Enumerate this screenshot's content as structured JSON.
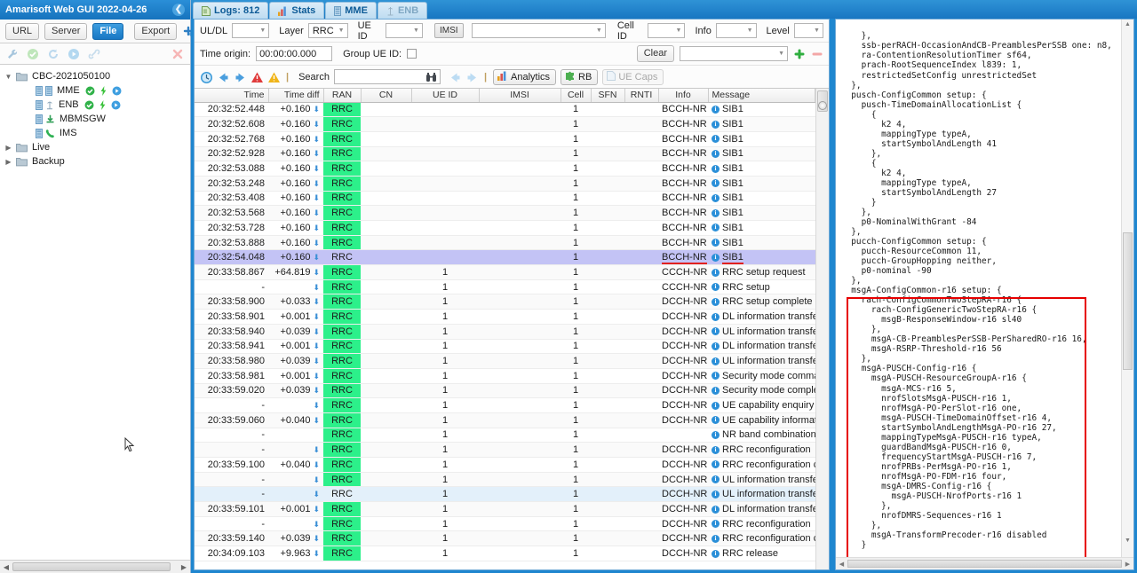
{
  "window": {
    "title": "Amarisoft Web GUI 2022-04-26",
    "collapse_icon": "chevron-left-icon"
  },
  "left_panel": {
    "source_buttons": [
      {
        "label": "URL",
        "active": false
      },
      {
        "label": "Server",
        "active": false
      },
      {
        "label": "File",
        "active": true
      }
    ],
    "export_label": "Export",
    "add_icon": "add-config-icon",
    "action_icons": [
      "wrench-icon",
      "check-circle-icon",
      "refresh-icon",
      "play-circle-icon",
      "link-icon"
    ],
    "delete_icon": "delete-x-icon",
    "tree": [
      {
        "label": "CBC-2021050100",
        "depth": 0,
        "expanded": true,
        "icon": "folder-icon",
        "badges": []
      },
      {
        "label": "MME",
        "depth": 1,
        "expanded": null,
        "icon": "server-icon",
        "badges": [
          "status-ok-icon",
          "bolt-icon",
          "play-icon"
        ]
      },
      {
        "label": "ENB",
        "depth": 1,
        "expanded": null,
        "icon": "antenna-icon",
        "badges": [
          "status-ok-icon",
          "bolt-icon",
          "play-icon"
        ]
      },
      {
        "label": "MBMSGW",
        "depth": 1,
        "expanded": null,
        "icon": "download-icon",
        "badges": []
      },
      {
        "label": "IMS",
        "depth": 1,
        "expanded": null,
        "icon": "phone-icon",
        "badges": []
      },
      {
        "label": "Live",
        "depth": 0,
        "expanded": false,
        "icon": "folder-icon",
        "badges": []
      },
      {
        "label": "Backup",
        "depth": 0,
        "expanded": false,
        "icon": "folder-icon",
        "badges": []
      }
    ]
  },
  "tabs": [
    {
      "label": "Logs: 812",
      "icon": "document-icon",
      "active": true,
      "disabled": false
    },
    {
      "label": "Stats",
      "icon": "bar-chart-icon",
      "active": false,
      "disabled": false
    },
    {
      "label": "MME",
      "icon": "server-icon",
      "active": false,
      "disabled": false
    },
    {
      "label": "ENB",
      "icon": "antenna-icon",
      "active": false,
      "disabled": true
    }
  ],
  "filters": {
    "uldl_label": "UL/DL",
    "uldl_value": "",
    "layer_label": "Layer",
    "layer_value": "RRC",
    "ueid_label": "UE ID",
    "ueid_value": "",
    "imsi_button": "IMSI",
    "imsi_value": "",
    "cellid_label": "Cell ID",
    "cellid_value": "",
    "info_label": "Info",
    "info_value": "",
    "level_label": "Level",
    "level_value": ""
  },
  "filters2": {
    "time_origin_label": "Time origin:",
    "time_origin_value": "00:00:00.000",
    "group_ueid_label": "Group UE ID:",
    "group_ueid_checked": false,
    "clear_label": "Clear",
    "preset_value": "",
    "add_icon": "plus-green-icon",
    "remove_icon": "minus-red-icon"
  },
  "toolbar": {
    "clock_icon": "clock-icon",
    "prev_icon": "arrow-left-icon",
    "next_icon": "arrow-right-icon",
    "error_icon": "error-triangle-icon",
    "warn_icon": "warning-triangle-icon",
    "search_label": "Search",
    "search_value": "",
    "search_placeholder": "",
    "binoculars_icon": "binoculars-icon",
    "search_prev_icon": "arrow-left-icon",
    "search_next_icon": "arrow-right-icon",
    "analytics_label": "Analytics",
    "analytics_icon": "bar-chart-icon",
    "rb_label": "RB",
    "rb_icon": "puzzle-icon",
    "uecaps_label": "UE Caps",
    "uecaps_icon": "document-icon",
    "uecaps_disabled": true
  },
  "table": {
    "columns": [
      "Time",
      "Time diff",
      "RAN",
      "CN",
      "UE ID",
      "IMSI",
      "Cell",
      "SFN",
      "RNTI",
      "Info",
      "Message"
    ],
    "rows": [
      {
        "time": "20:32:52.448",
        "diff": "+0.160",
        "arrow": true,
        "ran": "RRC",
        "cn": "",
        "ueid": "",
        "imsi": "",
        "cell": "1",
        "sfn": "",
        "rnti": "",
        "info": "BCCH-NR",
        "message": "SIB1",
        "state": ""
      },
      {
        "time": "20:32:52.608",
        "diff": "+0.160",
        "arrow": true,
        "ran": "RRC",
        "cn": "",
        "ueid": "",
        "imsi": "",
        "cell": "1",
        "sfn": "",
        "rnti": "",
        "info": "BCCH-NR",
        "message": "SIB1",
        "state": ""
      },
      {
        "time": "20:32:52.768",
        "diff": "+0.160",
        "arrow": true,
        "ran": "RRC",
        "cn": "",
        "ueid": "",
        "imsi": "",
        "cell": "1",
        "sfn": "",
        "rnti": "",
        "info": "BCCH-NR",
        "message": "SIB1",
        "state": ""
      },
      {
        "time": "20:32:52.928",
        "diff": "+0.160",
        "arrow": true,
        "ran": "RRC",
        "cn": "",
        "ueid": "",
        "imsi": "",
        "cell": "1",
        "sfn": "",
        "rnti": "",
        "info": "BCCH-NR",
        "message": "SIB1",
        "state": ""
      },
      {
        "time": "20:32:53.088",
        "diff": "+0.160",
        "arrow": true,
        "ran": "RRC",
        "cn": "",
        "ueid": "",
        "imsi": "",
        "cell": "1",
        "sfn": "",
        "rnti": "",
        "info": "BCCH-NR",
        "message": "SIB1",
        "state": ""
      },
      {
        "time": "20:32:53.248",
        "diff": "+0.160",
        "arrow": true,
        "ran": "RRC",
        "cn": "",
        "ueid": "",
        "imsi": "",
        "cell": "1",
        "sfn": "",
        "rnti": "",
        "info": "BCCH-NR",
        "message": "SIB1",
        "state": ""
      },
      {
        "time": "20:32:53.408",
        "diff": "+0.160",
        "arrow": true,
        "ran": "RRC",
        "cn": "",
        "ueid": "",
        "imsi": "",
        "cell": "1",
        "sfn": "",
        "rnti": "",
        "info": "BCCH-NR",
        "message": "SIB1",
        "state": ""
      },
      {
        "time": "20:32:53.568",
        "diff": "+0.160",
        "arrow": true,
        "ran": "RRC",
        "cn": "",
        "ueid": "",
        "imsi": "",
        "cell": "1",
        "sfn": "",
        "rnti": "",
        "info": "BCCH-NR",
        "message": "SIB1",
        "state": ""
      },
      {
        "time": "20:32:53.728",
        "diff": "+0.160",
        "arrow": true,
        "ran": "RRC",
        "cn": "",
        "ueid": "",
        "imsi": "",
        "cell": "1",
        "sfn": "",
        "rnti": "",
        "info": "BCCH-NR",
        "message": "SIB1",
        "state": ""
      },
      {
        "time": "20:32:53.888",
        "diff": "+0.160",
        "arrow": true,
        "ran": "RRC",
        "cn": "",
        "ueid": "",
        "imsi": "",
        "cell": "1",
        "sfn": "",
        "rnti": "",
        "info": "BCCH-NR",
        "message": "SIB1",
        "state": ""
      },
      {
        "time": "20:32:54.048",
        "diff": "+0.160",
        "arrow": true,
        "ran": "RRC",
        "cn": "",
        "ueid": "",
        "imsi": "",
        "cell": "1",
        "sfn": "",
        "rnti": "",
        "info": "BCCH-NR",
        "message": "SIB1",
        "state": "selected",
        "underline": true
      },
      {
        "time": "20:33:58.867",
        "diff": "+64.819",
        "arrow": true,
        "ran": "RRC",
        "cn": "",
        "ueid": "1",
        "imsi": "",
        "cell": "1",
        "sfn": "",
        "rnti": "",
        "info": "CCCH-NR",
        "message": "RRC setup request",
        "state": ""
      },
      {
        "time": "-",
        "diff": "",
        "arrow": true,
        "ran": "RRC",
        "cn": "",
        "ueid": "1",
        "imsi": "",
        "cell": "1",
        "sfn": "",
        "rnti": "",
        "info": "CCCH-NR",
        "message": "RRC setup",
        "state": ""
      },
      {
        "time": "20:33:58.900",
        "diff": "+0.033",
        "arrow": true,
        "ran": "RRC",
        "cn": "",
        "ueid": "1",
        "imsi": "",
        "cell": "1",
        "sfn": "",
        "rnti": "",
        "info": "DCCH-NR",
        "message": "RRC setup complete",
        "state": ""
      },
      {
        "time": "20:33:58.901",
        "diff": "+0.001",
        "arrow": true,
        "ran": "RRC",
        "cn": "",
        "ueid": "1",
        "imsi": "",
        "cell": "1",
        "sfn": "",
        "rnti": "",
        "info": "DCCH-NR",
        "message": "DL information transfer",
        "state": ""
      },
      {
        "time": "20:33:58.940",
        "diff": "+0.039",
        "arrow": true,
        "ran": "RRC",
        "cn": "",
        "ueid": "1",
        "imsi": "",
        "cell": "1",
        "sfn": "",
        "rnti": "",
        "info": "DCCH-NR",
        "message": "UL information transfer",
        "state": ""
      },
      {
        "time": "20:33:58.941",
        "diff": "+0.001",
        "arrow": true,
        "ran": "RRC",
        "cn": "",
        "ueid": "1",
        "imsi": "",
        "cell": "1",
        "sfn": "",
        "rnti": "",
        "info": "DCCH-NR",
        "message": "DL information transfer",
        "state": ""
      },
      {
        "time": "20:33:58.980",
        "diff": "+0.039",
        "arrow": true,
        "ran": "RRC",
        "cn": "",
        "ueid": "1",
        "imsi": "",
        "cell": "1",
        "sfn": "",
        "rnti": "",
        "info": "DCCH-NR",
        "message": "UL information transfer",
        "state": ""
      },
      {
        "time": "20:33:58.981",
        "diff": "+0.001",
        "arrow": true,
        "ran": "RRC",
        "cn": "",
        "ueid": "1",
        "imsi": "",
        "cell": "1",
        "sfn": "",
        "rnti": "",
        "info": "DCCH-NR",
        "message": "Security mode command",
        "state": ""
      },
      {
        "time": "20:33:59.020",
        "diff": "+0.039",
        "arrow": true,
        "ran": "RRC",
        "cn": "",
        "ueid": "1",
        "imsi": "",
        "cell": "1",
        "sfn": "",
        "rnti": "",
        "info": "DCCH-NR",
        "message": "Security mode complete",
        "state": ""
      },
      {
        "time": "-",
        "diff": "",
        "arrow": true,
        "ran": "RRC",
        "cn": "",
        "ueid": "1",
        "imsi": "",
        "cell": "1",
        "sfn": "",
        "rnti": "",
        "info": "DCCH-NR",
        "message": "UE capability enquiry",
        "state": ""
      },
      {
        "time": "20:33:59.060",
        "diff": "+0.040",
        "arrow": true,
        "ran": "RRC",
        "cn": "",
        "ueid": "1",
        "imsi": "",
        "cell": "1",
        "sfn": "",
        "rnti": "",
        "info": "DCCH-NR",
        "message": "UE capability information",
        "state": ""
      },
      {
        "time": "-",
        "diff": "",
        "arrow": false,
        "ran": "RRC",
        "cn": "",
        "ueid": "1",
        "imsi": "",
        "cell": "1",
        "sfn": "",
        "rnti": "",
        "info": "",
        "message": "NR band combinations",
        "state": ""
      },
      {
        "time": "-",
        "diff": "",
        "arrow": true,
        "ran": "RRC",
        "cn": "",
        "ueid": "1",
        "imsi": "",
        "cell": "1",
        "sfn": "",
        "rnti": "",
        "info": "DCCH-NR",
        "message": "RRC reconfiguration",
        "state": ""
      },
      {
        "time": "20:33:59.100",
        "diff": "+0.040",
        "arrow": true,
        "ran": "RRC",
        "cn": "",
        "ueid": "1",
        "imsi": "",
        "cell": "1",
        "sfn": "",
        "rnti": "",
        "info": "DCCH-NR",
        "message": "RRC reconfiguration complete",
        "state": ""
      },
      {
        "time": "-",
        "diff": "",
        "arrow": true,
        "ran": "RRC",
        "cn": "",
        "ueid": "1",
        "imsi": "",
        "cell": "1",
        "sfn": "",
        "rnti": "",
        "info": "DCCH-NR",
        "message": "UL information transfer",
        "state": ""
      },
      {
        "time": "-",
        "diff": "",
        "arrow": true,
        "ran": "RRC",
        "cn": "",
        "ueid": "1",
        "imsi": "",
        "cell": "1",
        "sfn": "",
        "rnti": "",
        "info": "DCCH-NR",
        "message": "UL information transfer",
        "state": "hovered"
      },
      {
        "time": "20:33:59.101",
        "diff": "+0.001",
        "arrow": true,
        "ran": "RRC",
        "cn": "",
        "ueid": "1",
        "imsi": "",
        "cell": "1",
        "sfn": "",
        "rnti": "",
        "info": "DCCH-NR",
        "message": "DL information transfer",
        "state": ""
      },
      {
        "time": "-",
        "diff": "",
        "arrow": true,
        "ran": "RRC",
        "cn": "",
        "ueid": "1",
        "imsi": "",
        "cell": "1",
        "sfn": "",
        "rnti": "",
        "info": "DCCH-NR",
        "message": "RRC reconfiguration",
        "state": ""
      },
      {
        "time": "20:33:59.140",
        "diff": "+0.039",
        "arrow": true,
        "ran": "RRC",
        "cn": "",
        "ueid": "1",
        "imsi": "",
        "cell": "1",
        "sfn": "",
        "rnti": "",
        "info": "DCCH-NR",
        "message": "RRC reconfiguration complete",
        "state": ""
      },
      {
        "time": "20:34:09.103",
        "diff": "+9.963",
        "arrow": true,
        "ran": "RRC",
        "cn": "",
        "ueid": "1",
        "imsi": "",
        "cell": "1",
        "sfn": "",
        "rnti": "",
        "info": "DCCH-NR",
        "message": "RRC release",
        "state": ""
      }
    ]
  },
  "detail": {
    "text": "    },\n    ssb-perRACH-OccasionAndCB-PreamblesPerSSB one: n8,\n    ra-ContentionResolutionTimer sf64,\n    prach-RootSequenceIndex l839: 1,\n    restrictedSetConfig unrestrictedSet\n  },\n  pusch-ConfigCommon setup: {\n    pusch-TimeDomainAllocationList {\n      {\n        k2 4,\n        mappingType typeA,\n        startSymbolAndLength 41\n      },\n      {\n        k2 4,\n        mappingType typeA,\n        startSymbolAndLength 27\n      }\n    },\n    p0-NominalWithGrant -84\n  },\n  pucch-ConfigCommon setup: {\n    pucch-ResourceCommon 11,\n    pucch-GroupHopping neither,\n    p0-nominal -90\n  },\n  msgA-ConfigCommon-r16 setup: {\n    rach-ConfigCommonTwoStepRA-r16 {\n      rach-ConfigGenericTwoStepRA-r16 {\n        msgB-ResponseWindow-r16 sl40\n      },\n      msgA-CB-PreamblesPerSSB-PerSharedRO-r16 16,\n      msgA-RSRP-Threshold-r16 56\n    },\n    msgA-PUSCH-Config-r16 {\n      msgA-PUSCH-ResourceGroupA-r16 {\n        msgA-MCS-r16 5,\n        nrofSlotsMsgA-PUSCH-r16 1,\n        nrofMsgA-PO-PerSlot-r16 one,\n        msgA-PUSCH-TimeDomainOffset-r16 4,\n        startSymbolAndLengthMsgA-PO-r16 27,\n        mappingTypeMsgA-PUSCH-r16 typeA,\n        guardBandMsgA-PUSCH-r16 0,\n        frequencyStartMsgA-PUSCH-r16 7,\n        nrofPRBs-PerMsgA-PO-r16 1,\n        nrofMsgA-PO-FDM-r16 four,\n        msgA-DMRS-Config-r16 {\n          msgA-PUSCH-NrofPorts-r16 1\n        },\n        nrofDMRS-Sequences-r16 1\n      },\n      msgA-TransformPrecoder-r16 disabled\n    }\n  }",
    "highlight_color": "#e60000"
  }
}
